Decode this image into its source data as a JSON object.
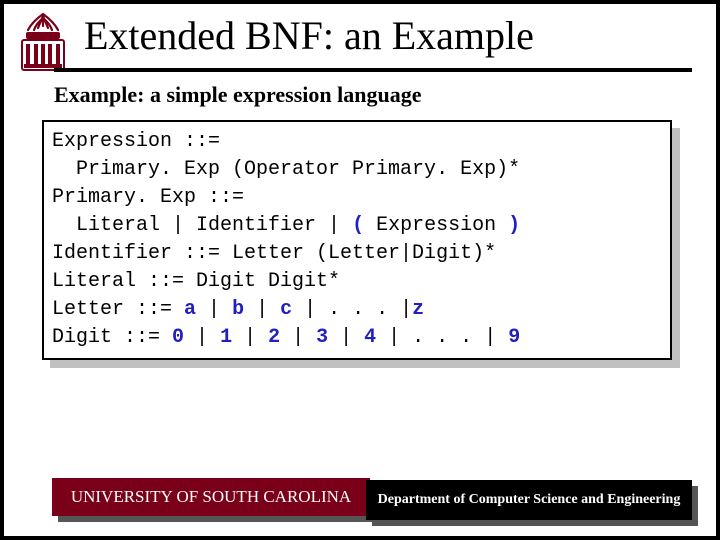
{
  "title": "Extended BNF: an Example",
  "subtitle": "Example: a simple expression language",
  "code": {
    "l1a": "Expression ::=",
    "l2a": "  Primary. Exp (Operator Primary. Exp)*",
    "l3a": "Primary. Exp ::=",
    "l4a": "  Literal | Identifier | ",
    "l4paren1": "(",
    "l4b": " Expression ",
    "l4paren2": ")",
    "l5a": "Identifier ::= Letter (Letter|Digit)*",
    "l6a": "Literal ::= Digit Digit*",
    "l7a": "Letter ::= ",
    "l7b": "a",
    "l7c": " | ",
    "l7d": "b",
    "l7e": " | ",
    "l7f": "c",
    "l7g": " | . . . |",
    "l7h": "z",
    "l8a": "Digit ::= ",
    "l8b": "0",
    "l8c": " | ",
    "l8d": "1",
    "l8e": " | ",
    "l8f": "2",
    "l8g": " | ",
    "l8h": "3",
    "l8i": " | ",
    "l8j": "4",
    "l8k": " | . . . | ",
    "l8l": "9"
  },
  "footer": {
    "left": "UNIVERSITY OF SOUTH CAROLINA",
    "right": "Department of Computer Science and Engineering"
  },
  "logo": {
    "name": "university-seal"
  }
}
